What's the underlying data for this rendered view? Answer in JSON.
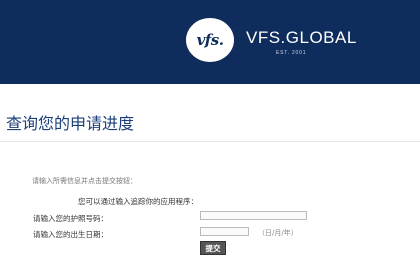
{
  "header": {
    "logo_text": "vfs.",
    "brand": "VFS.GLOBAL",
    "est": "EST. 2001",
    "background_color": "#0e2c5c"
  },
  "page": {
    "title": "查询您的申请进度"
  },
  "form": {
    "instruction": "请输入所需信息并点击提交按钮：",
    "subheading": "您可以通过输入追踪你的应用程序：",
    "passport_label": "请输入您的护照号码：",
    "passport_value": "",
    "dob_label": "请输入您的出生日期：",
    "dob_value": "",
    "dob_hint": "（日/月/年）",
    "submit_label": "提交"
  }
}
